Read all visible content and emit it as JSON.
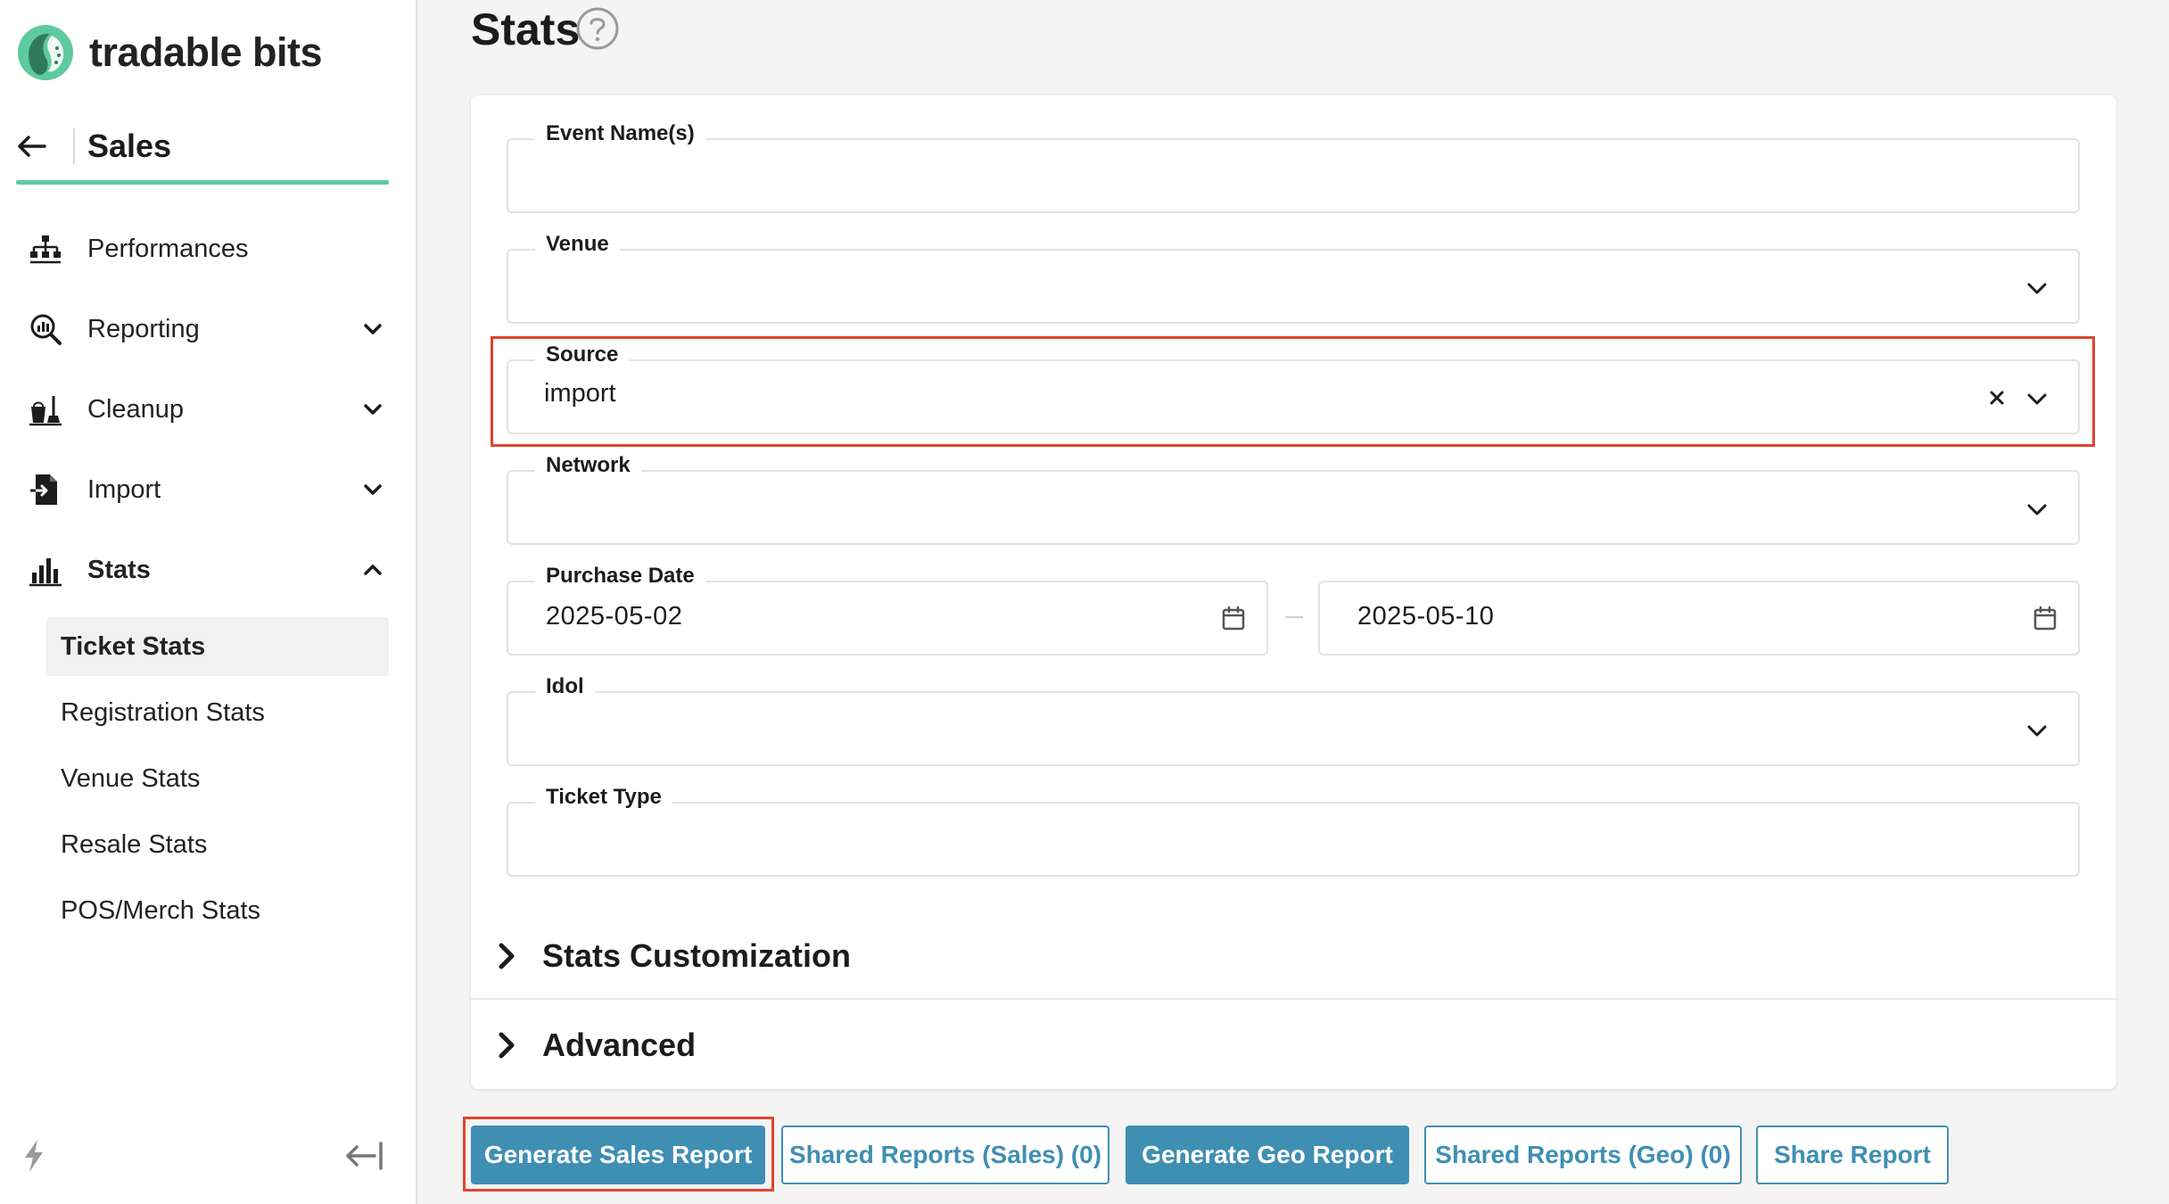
{
  "brand": {
    "name": "tradable bits",
    "accent": "#5fc9a0",
    "primary": "#3f8fb3",
    "highlight": "#e0442e"
  },
  "sidebar": {
    "section_title": "Sales",
    "items": [
      {
        "label": "Performances",
        "icon": "sitemap-icon"
      },
      {
        "label": "Reporting",
        "icon": "magnifier-chart-icon",
        "expandable": true
      },
      {
        "label": "Cleanup",
        "icon": "broom-bucket-icon",
        "expandable": true
      },
      {
        "label": "Import",
        "icon": "file-import-icon",
        "expandable": true
      },
      {
        "label": "Stats",
        "icon": "bar-chart-icon",
        "expanded": true
      }
    ],
    "stats_subitems": [
      {
        "label": "Ticket Stats",
        "active": true
      },
      {
        "label": "Registration Stats"
      },
      {
        "label": "Venue Stats"
      },
      {
        "label": "Resale Stats"
      },
      {
        "label": "POS/Merch Stats"
      }
    ]
  },
  "page": {
    "title": "Stats",
    "help_icon": "question-circle-icon"
  },
  "form": {
    "event_names": {
      "label": "Event Name(s)",
      "value": ""
    },
    "venue": {
      "label": "Venue",
      "value": ""
    },
    "source": {
      "label": "Source",
      "value": "import"
    },
    "network": {
      "label": "Network",
      "value": ""
    },
    "purchase_date": {
      "label": "Purchase Date",
      "start": "2025-05-02",
      "end": "2025-05-10"
    },
    "idol": {
      "label": "Idol",
      "value": ""
    },
    "ticket_type": {
      "label": "Ticket Type",
      "value": ""
    }
  },
  "accordions": {
    "customization": "Stats Customization",
    "advanced": "Advanced"
  },
  "buttons": {
    "generate_sales": "Generate Sales Report",
    "shared_sales": "Shared Reports (Sales) (0)",
    "generate_geo": "Generate Geo Report",
    "shared_geo": "Shared Reports (Geo) (0)",
    "share": "Share Report"
  }
}
